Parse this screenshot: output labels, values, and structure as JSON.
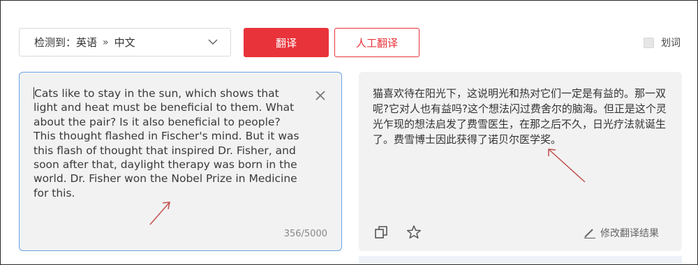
{
  "language_selector": {
    "detected_label": "检测到：英语",
    "separator": "»",
    "target_language": "中文"
  },
  "buttons": {
    "translate": "翻译",
    "human_translate": "人工翻译"
  },
  "word_pick": {
    "label": "划词"
  },
  "source": {
    "text": "Cats like to stay in the sun, which shows that light and heat must be beneficial to them. What about the pair? Is it also beneficial to people? This thought flashed in Fischer's mind. But it was this flash of thought that inspired Dr. Fisher, and soon after that, daylight therapy was born in the world. Dr. Fisher won the Nobel Prize in Medicine for this.",
    "char_count": "356/5000"
  },
  "target": {
    "text": "猫喜欢待在阳光下，这说明光和热对它们一定是有益的。那一双呢?它对人也有益吗?这个想法闪过费舍尔的脑海。但正是这个灵光乍现的想法启发了费雪医生，在那之后不久，日光疗法就诞生了。费雪博士因此获得了诺贝尔医学奖。",
    "edit_label": "修改翻译结果"
  },
  "icons": {
    "clear": "close-icon",
    "copy": "copy-icon",
    "favorite": "star-icon",
    "edit": "pencil-icon",
    "dropdown": "chevron-down-icon"
  },
  "colors": {
    "accent": "#e8333a",
    "focus_border": "#6aa2e6",
    "annotation_arrow": "#c0504d"
  }
}
